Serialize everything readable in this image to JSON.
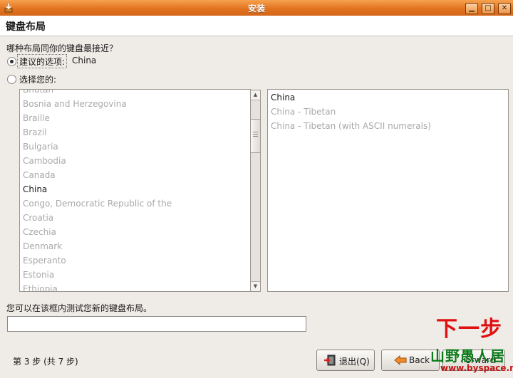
{
  "window": {
    "title": "安装",
    "min_label": "▁",
    "max_label": "□",
    "close_label": "✕"
  },
  "header": {
    "title": "键盘布局"
  },
  "question": "哪种布局同你的键盘最接近？",
  "suggested": {
    "label": "建议的选项:",
    "value": "China",
    "selected": true
  },
  "choose": {
    "label": "选择您的:"
  },
  "layouts": [
    {
      "label": "Bhutan",
      "active": false
    },
    {
      "label": "Bosnia and Herzegovina",
      "active": false
    },
    {
      "label": "Braille",
      "active": false
    },
    {
      "label": "Brazil",
      "active": false
    },
    {
      "label": "Bulgaria",
      "active": false
    },
    {
      "label": "Cambodia",
      "active": false
    },
    {
      "label": "Canada",
      "active": false
    },
    {
      "label": "China",
      "active": true
    },
    {
      "label": "Congo, Democratic Republic of the",
      "active": false
    },
    {
      "label": "Croatia",
      "active": false
    },
    {
      "label": "Czechia",
      "active": false
    },
    {
      "label": "Denmark",
      "active": false
    },
    {
      "label": "Esperanto",
      "active": false
    },
    {
      "label": "Estonia",
      "active": false
    },
    {
      "label": "Ethiopia",
      "active": false
    }
  ],
  "variants": [
    {
      "label": "China",
      "active": true
    },
    {
      "label": "China - Tibetan",
      "active": false
    },
    {
      "label": "China - Tibetan (with ASCII numerals)",
      "active": false
    }
  ],
  "test": {
    "label": "您可以在该框内测试您新的键盘布局。",
    "value": ""
  },
  "footer": {
    "step_text": "第 3 步 (共 7 步)",
    "quit_label": "退出(Q)",
    "back_label": "Back",
    "forward_label": "Forward"
  },
  "annotation": {
    "text": "下一步"
  },
  "watermark": {
    "text": "山野愚人居",
    "url": "www.byspace.net"
  }
}
